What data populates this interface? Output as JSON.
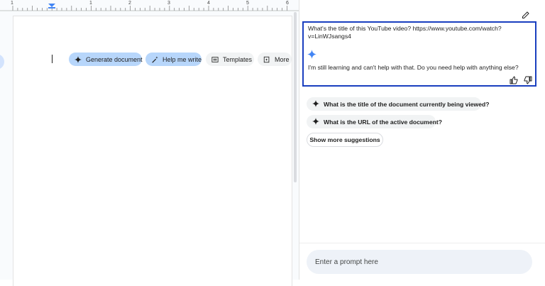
{
  "ruler": {
    "numbers": [
      "1",
      "1",
      "2",
      "3",
      "4",
      "5",
      "6"
    ]
  },
  "doc": {
    "chips": {
      "generate_document": "Generate document",
      "help_me_write": "Help me write",
      "templates": "Templates",
      "more": "More"
    }
  },
  "panel": {
    "user_question": "What's the title of this YouTube video? https://www.youtube.com/watch?v=LinWJsangs4",
    "response": "I'm still learning and can't help with that. Do you need help with anything else?",
    "suggestions": [
      "What is the title of the document currently being viewed?",
      "What is the URL of the active document?"
    ],
    "show_more": "Show more suggestions",
    "prompt_placeholder": "Enter a prompt here"
  },
  "colors": {
    "highlight_border": "#1a3fbf",
    "chip_blue": "#b7d6fb",
    "gemini_blue": "#4285f4"
  },
  "icons": [
    "gemini-sparkle-icon",
    "pen-sparkle-icon",
    "template-icon",
    "more-icon",
    "edit-pencil-icon",
    "thumbs-up-icon",
    "thumbs-down-icon",
    "indent-marker-icon"
  ]
}
